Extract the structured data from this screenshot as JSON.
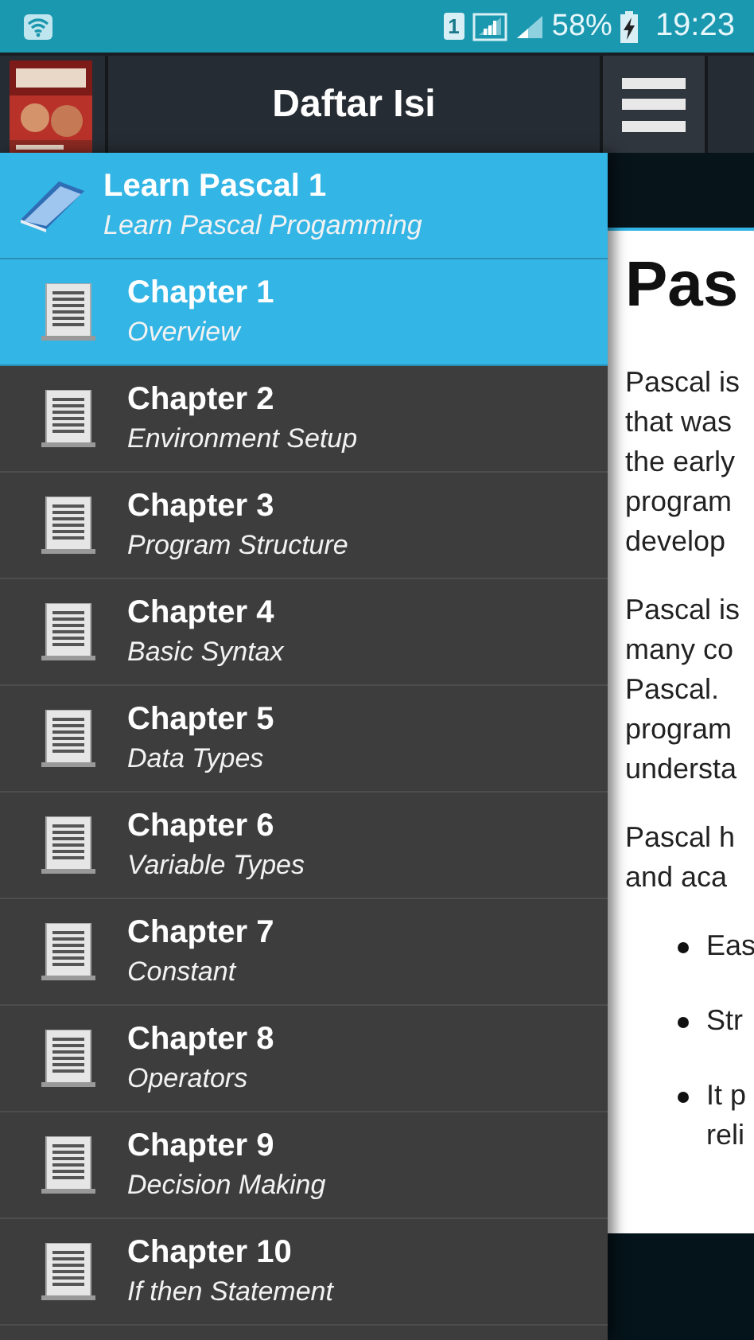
{
  "status_bar": {
    "sim": "1",
    "battery": "58%",
    "time": "19:23"
  },
  "toolbar": {
    "title": "Daftar Isi"
  },
  "drawer": {
    "header": {
      "title": "Learn Pascal 1",
      "subtitle": "Learn Pascal Progamming"
    },
    "items": [
      {
        "title": "Chapter 1",
        "subtitle": "Overview",
        "selected": true
      },
      {
        "title": "Chapter 2",
        "subtitle": "Environment Setup",
        "selected": false
      },
      {
        "title": "Chapter 3",
        "subtitle": "Program Structure",
        "selected": false
      },
      {
        "title": "Chapter 4",
        "subtitle": "Basic Syntax",
        "selected": false
      },
      {
        "title": "Chapter 5",
        "subtitle": "Data Types",
        "selected": false
      },
      {
        "title": "Chapter 6",
        "subtitle": "Variable Types",
        "selected": false
      },
      {
        "title": "Chapter 7",
        "subtitle": "Constant",
        "selected": false
      },
      {
        "title": "Chapter 8",
        "subtitle": "Operators",
        "selected": false
      },
      {
        "title": "Chapter 9",
        "subtitle": "Decision Making",
        "selected": false
      },
      {
        "title": "Chapter 10",
        "subtitle": "If then Statement",
        "selected": false
      }
    ]
  },
  "content": {
    "heading": "Pas",
    "paragraphs": [
      [
        "Pascal is",
        "that was",
        "the early",
        "program",
        "develop"
      ],
      [
        "Pascal is",
        "many co",
        "Pascal.",
        "program",
        "understa"
      ],
      [
        "Pascal h",
        "and aca"
      ]
    ],
    "bullets": [
      [
        "Eas"
      ],
      [
        "Str"
      ],
      [
        "It p",
        "reli"
      ]
    ]
  }
}
